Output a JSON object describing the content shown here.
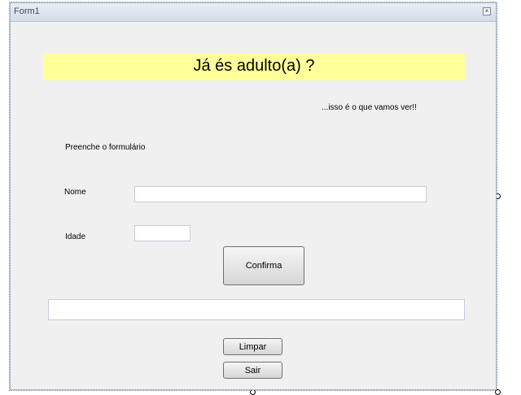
{
  "window": {
    "title": "Form1",
    "close_glyph": "☒"
  },
  "banner": {
    "text": "Já és adulto(a) ?",
    "bg_color": "#ffff99"
  },
  "subtitle": "...isso é o que vamos ver!!",
  "instructions": "Preenche o formulário",
  "fields": {
    "name_label": "Nome",
    "name_value": "",
    "age_label": "Idade",
    "age_value": ""
  },
  "buttons": {
    "confirm": "Confirma",
    "clear": "Limpar",
    "exit": "Sair"
  },
  "result_text": ""
}
